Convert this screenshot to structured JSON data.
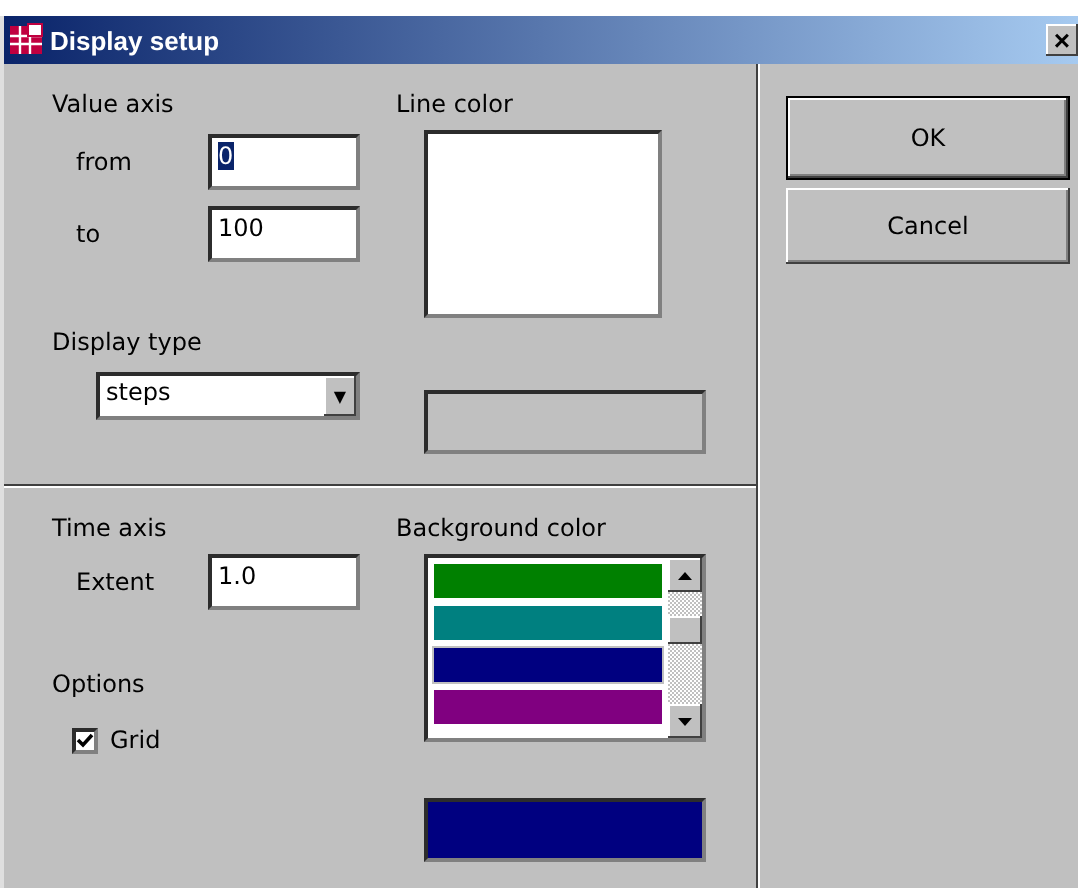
{
  "window": {
    "title": "Display setup",
    "close": "×"
  },
  "value_axis": {
    "heading": "Value axis",
    "fields": [
      {
        "label": "from",
        "value": "0",
        "text_selected": true
      },
      {
        "label": "to",
        "value": "100",
        "text_selected": false
      }
    ]
  },
  "display_type": {
    "label": "Display type",
    "value": "steps",
    "arrow": "▼"
  },
  "line_color": {
    "label": "Line color"
  },
  "time_axis": {
    "heading": "Time axis",
    "fields": [
      {
        "label": "Extent",
        "value": "1.0",
        "text_selected": false
      }
    ]
  },
  "options": {
    "heading": "Options",
    "checkboxes": [
      {
        "label": "Grid",
        "checked": true
      }
    ]
  },
  "background_color": {
    "label": "Background color",
    "preview": {
      "color": "#000080"
    },
    "items": [
      {
        "color": "#008000",
        "selected": false
      },
      {
        "color": "#008080",
        "selected": false
      },
      {
        "color": "#000080",
        "selected": true
      },
      {
        "color": "#800080",
        "selected": false
      }
    ]
  },
  "buttons": [
    {
      "label": "OK",
      "default": true
    },
    {
      "label": "Cancel",
      "default": false
    }
  ]
}
